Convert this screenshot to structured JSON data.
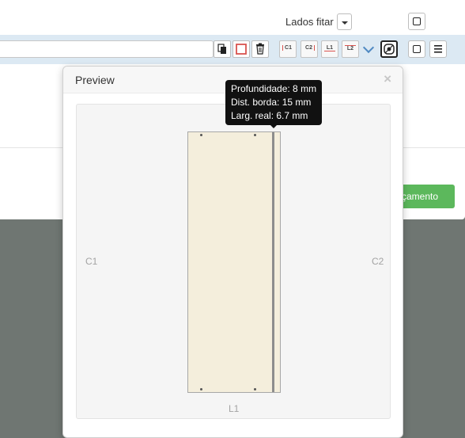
{
  "header": {
    "lados_label": "Lados fitar"
  },
  "toolbar": {
    "name_value": "",
    "side_buttons": [
      "C1",
      "C2",
      "L1",
      "L2"
    ]
  },
  "footer": {
    "budget_button_label": "rçamento"
  },
  "popover": {
    "title": "Preview",
    "close_label": "×",
    "sides": {
      "left": "C1",
      "right": "C2",
      "bottom": "L1"
    }
  },
  "tooltip": {
    "depth": "Profundidade: 8 mm",
    "edge_distance": "Dist. borda: 15 mm",
    "real_width": "Larg. real: 6.7 mm"
  },
  "colors": {
    "accent_green": "#5cb85c",
    "toolbar_blue": "#dce9f3",
    "piece_fill": "#f4eedc",
    "edge_red": "#d9534f"
  }
}
